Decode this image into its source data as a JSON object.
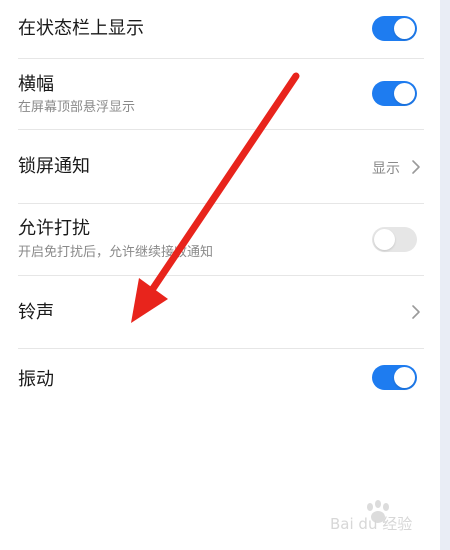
{
  "settings": {
    "status_bar": {
      "title": "在状态栏上显示",
      "enabled": true
    },
    "banner": {
      "title": "横幅",
      "subtitle": "在屏幕顶部悬浮显示",
      "enabled": true
    },
    "lock_screen": {
      "title": "锁屏通知",
      "value": "显示"
    },
    "allow_dnd": {
      "title": "允许打扰",
      "subtitle": "开启免打扰后，允许继续接收通知",
      "enabled": false
    },
    "ringtone": {
      "title": "铃声"
    },
    "vibration": {
      "title": "振动",
      "enabled": true
    }
  },
  "annotation": {
    "arrow_color": "#e8241c"
  },
  "watermark": {
    "text": "Bai du 经验"
  },
  "colors": {
    "accent": "#1e7cf0",
    "toggle_off": "#e6e6e6",
    "secondary_text": "#8a8a8a"
  }
}
